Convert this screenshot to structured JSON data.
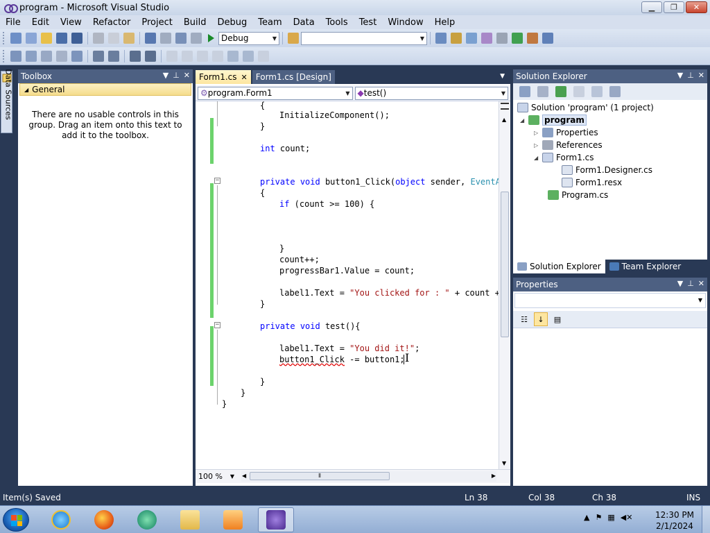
{
  "window": {
    "title": "program - Microsoft Visual Studio",
    "minimize": "▁",
    "maximize": "❐",
    "close": "✕"
  },
  "menu": [
    "File",
    "Edit",
    "View",
    "Refactor",
    "Project",
    "Build",
    "Debug",
    "Team",
    "Data",
    "Tools",
    "Test",
    "Window",
    "Help"
  ],
  "toolbar": {
    "config": "Debug",
    "platform": ""
  },
  "data_sources_tab": "Data Sources",
  "toolbox": {
    "title": "Toolbox",
    "group": "General",
    "empty_message": "There are no usable controls in this group. Drag an item onto this text to add it to the toolbox."
  },
  "editor": {
    "tabs": [
      {
        "label": "Form1.cs",
        "active": true
      },
      {
        "label": "Form1.cs [Design]",
        "active": false
      }
    ],
    "class_combo": "program.Form1",
    "member_combo": "test()",
    "zoom": "100 %",
    "code": {
      "l1": "{",
      "l2": "InitializeComponent();",
      "l3": "}",
      "l4_kw": "int",
      "l4_rest": " count;",
      "l5_kw1": "private",
      "l5_kw2": "void",
      "l5_name": " button1_Click(",
      "l5_kw3": "object",
      "l5_mid": " sender, ",
      "l5_type": "EventAr",
      "l6": "{",
      "l7_kw": "if",
      "l7_rest": " (count >= 100) {",
      "l8": "}",
      "l9": "count++;",
      "l10": "progressBar1.Value = count;",
      "l11_pre": "label1.Text = ",
      "l11_str": "\"You clicked for : \"",
      "l11_post": " + count +",
      "l12": "}",
      "l13_kw1": "private",
      "l13_kw2": "void",
      "l13_rest": " test(){",
      "l14_pre": "label1.Text = ",
      "l14_str": "\"You did it!\"",
      "l14_post": ";",
      "l15_err": "button1_Click",
      "l15_rest": " -= button1;",
      "l16": "}",
      "l17": "}",
      "l18": "}"
    }
  },
  "solution_explorer": {
    "title": "Solution Explorer",
    "solution": "Solution 'program' (1 project)",
    "project": "program",
    "properties": "Properties",
    "references": "References",
    "form1": "Form1.cs",
    "form1_designer": "Form1.Designer.cs",
    "form1_resx": "Form1.resx",
    "program_cs": "Program.cs",
    "tab_se": "Solution Explorer",
    "tab_te": "Team Explorer"
  },
  "properties": {
    "title": "Properties"
  },
  "status": {
    "message": "Item(s) Saved",
    "ln": "Ln 38",
    "col": "Col 38",
    "ch": "Ch 38",
    "mode": "INS"
  },
  "taskbar": {
    "time": "12:30 PM",
    "date": "2/1/2024"
  }
}
